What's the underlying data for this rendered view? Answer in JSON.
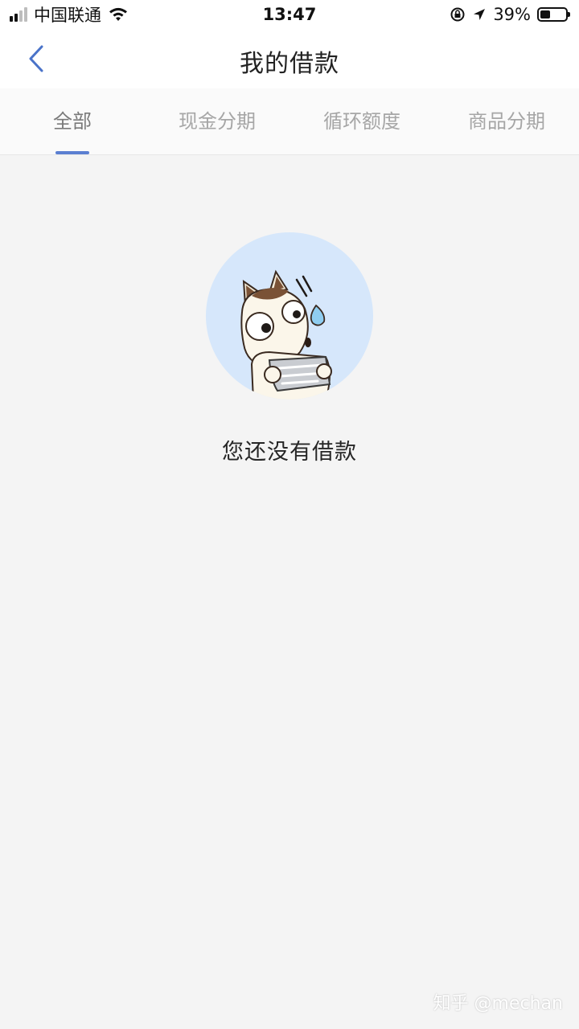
{
  "status_bar": {
    "carrier": "中国联通",
    "time": "13:47",
    "battery_percent": "39%",
    "battery_level": 0.39,
    "icons": [
      "signal-icon",
      "wifi-icon",
      "orientation-lock-icon",
      "location-arrow-icon",
      "battery-icon"
    ]
  },
  "header": {
    "title": "我的借款",
    "back_icon": "chevron-left-icon"
  },
  "tabs": [
    {
      "label": "全部",
      "active": true
    },
    {
      "label": "现金分期",
      "active": false
    },
    {
      "label": "循环额度",
      "active": false
    },
    {
      "label": "商品分期",
      "active": false
    }
  ],
  "empty_state": {
    "illustration": "cartoon-dog-holding-paper",
    "message": "您还没有借款"
  },
  "watermark": "知乎 @mechan",
  "colors": {
    "accent": "#5b7fd1",
    "background": "#f4f4f4",
    "circle": "#d6e7fb"
  }
}
